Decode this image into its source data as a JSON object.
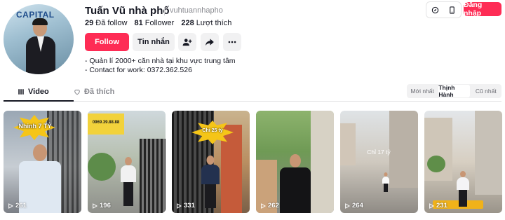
{
  "profile": {
    "name": "Tuấn Vũ nhà phố",
    "username": "vuhtuannhapho",
    "avatar_text": "CAPITAL",
    "stats": [
      {
        "value": "29",
        "label": "Đã follow"
      },
      {
        "value": "81",
        "label": "Follower"
      },
      {
        "value": "228",
        "label": "Lượt thích"
      }
    ],
    "bio": [
      "- Quản lí 2000+ căn nhà tại khu vực trung tâm",
      "- Contact for work: 0372.362.526"
    ]
  },
  "actions": {
    "follow_label": "Follow",
    "message_label": "Tin nhắn"
  },
  "header": {
    "login_label": "Đăng nhập"
  },
  "tabs": [
    {
      "label": "Video",
      "icon": "grid-icon"
    },
    {
      "label": "Đã thích",
      "icon": "heart-outline-icon"
    }
  ],
  "sort": {
    "options": [
      "Mới nhất",
      "Thịnh Hành",
      "Cũ nhất"
    ],
    "active": "Thịnh Hành"
  },
  "videos": [
    {
      "views": "261",
      "caption": "Nhỉnh 7 TỶ"
    },
    {
      "views": "196",
      "caption": "0969.39.88.88"
    },
    {
      "views": "331",
      "caption": "Chỉ 25 tỷ"
    },
    {
      "views": "262",
      "caption": ""
    },
    {
      "views": "264",
      "caption": "Chỉ 17 tỷ"
    },
    {
      "views": "231",
      "caption": ""
    }
  ],
  "colors": {
    "accent": "#fe2c55",
    "text": "#161823",
    "muted": "#8a8b91"
  }
}
